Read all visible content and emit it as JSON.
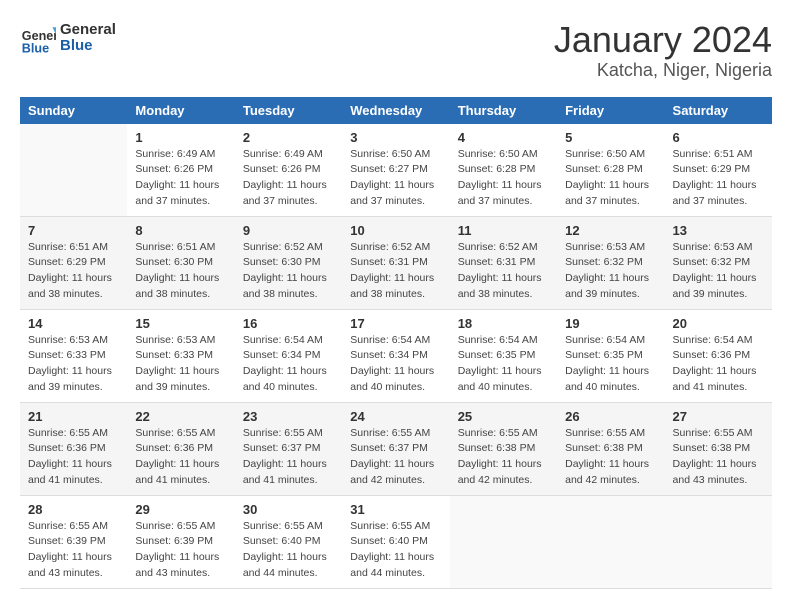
{
  "logo": {
    "text_general": "General",
    "text_blue": "Blue"
  },
  "title": {
    "month_year": "January 2024",
    "location": "Katcha, Niger, Nigeria"
  },
  "days_of_week": [
    "Sunday",
    "Monday",
    "Tuesday",
    "Wednesday",
    "Thursday",
    "Friday",
    "Saturday"
  ],
  "weeks": [
    [
      {
        "day": "",
        "info": ""
      },
      {
        "day": "1",
        "info": "Sunrise: 6:49 AM\nSunset: 6:26 PM\nDaylight: 11 hours\nand 37 minutes."
      },
      {
        "day": "2",
        "info": "Sunrise: 6:49 AM\nSunset: 6:26 PM\nDaylight: 11 hours\nand 37 minutes."
      },
      {
        "day": "3",
        "info": "Sunrise: 6:50 AM\nSunset: 6:27 PM\nDaylight: 11 hours\nand 37 minutes."
      },
      {
        "day": "4",
        "info": "Sunrise: 6:50 AM\nSunset: 6:28 PM\nDaylight: 11 hours\nand 37 minutes."
      },
      {
        "day": "5",
        "info": "Sunrise: 6:50 AM\nSunset: 6:28 PM\nDaylight: 11 hours\nand 37 minutes."
      },
      {
        "day": "6",
        "info": "Sunrise: 6:51 AM\nSunset: 6:29 PM\nDaylight: 11 hours\nand 37 minutes."
      }
    ],
    [
      {
        "day": "7",
        "info": "Sunrise: 6:51 AM\nSunset: 6:29 PM\nDaylight: 11 hours\nand 38 minutes."
      },
      {
        "day": "8",
        "info": "Sunrise: 6:51 AM\nSunset: 6:30 PM\nDaylight: 11 hours\nand 38 minutes."
      },
      {
        "day": "9",
        "info": "Sunrise: 6:52 AM\nSunset: 6:30 PM\nDaylight: 11 hours\nand 38 minutes."
      },
      {
        "day": "10",
        "info": "Sunrise: 6:52 AM\nSunset: 6:31 PM\nDaylight: 11 hours\nand 38 minutes."
      },
      {
        "day": "11",
        "info": "Sunrise: 6:52 AM\nSunset: 6:31 PM\nDaylight: 11 hours\nand 38 minutes."
      },
      {
        "day": "12",
        "info": "Sunrise: 6:53 AM\nSunset: 6:32 PM\nDaylight: 11 hours\nand 39 minutes."
      },
      {
        "day": "13",
        "info": "Sunrise: 6:53 AM\nSunset: 6:32 PM\nDaylight: 11 hours\nand 39 minutes."
      }
    ],
    [
      {
        "day": "14",
        "info": "Sunrise: 6:53 AM\nSunset: 6:33 PM\nDaylight: 11 hours\nand 39 minutes."
      },
      {
        "day": "15",
        "info": "Sunrise: 6:53 AM\nSunset: 6:33 PM\nDaylight: 11 hours\nand 39 minutes."
      },
      {
        "day": "16",
        "info": "Sunrise: 6:54 AM\nSunset: 6:34 PM\nDaylight: 11 hours\nand 40 minutes."
      },
      {
        "day": "17",
        "info": "Sunrise: 6:54 AM\nSunset: 6:34 PM\nDaylight: 11 hours\nand 40 minutes."
      },
      {
        "day": "18",
        "info": "Sunrise: 6:54 AM\nSunset: 6:35 PM\nDaylight: 11 hours\nand 40 minutes."
      },
      {
        "day": "19",
        "info": "Sunrise: 6:54 AM\nSunset: 6:35 PM\nDaylight: 11 hours\nand 40 minutes."
      },
      {
        "day": "20",
        "info": "Sunrise: 6:54 AM\nSunset: 6:36 PM\nDaylight: 11 hours\nand 41 minutes."
      }
    ],
    [
      {
        "day": "21",
        "info": "Sunrise: 6:55 AM\nSunset: 6:36 PM\nDaylight: 11 hours\nand 41 minutes."
      },
      {
        "day": "22",
        "info": "Sunrise: 6:55 AM\nSunset: 6:36 PM\nDaylight: 11 hours\nand 41 minutes."
      },
      {
        "day": "23",
        "info": "Sunrise: 6:55 AM\nSunset: 6:37 PM\nDaylight: 11 hours\nand 41 minutes."
      },
      {
        "day": "24",
        "info": "Sunrise: 6:55 AM\nSunset: 6:37 PM\nDaylight: 11 hours\nand 42 minutes."
      },
      {
        "day": "25",
        "info": "Sunrise: 6:55 AM\nSunset: 6:38 PM\nDaylight: 11 hours\nand 42 minutes."
      },
      {
        "day": "26",
        "info": "Sunrise: 6:55 AM\nSunset: 6:38 PM\nDaylight: 11 hours\nand 42 minutes."
      },
      {
        "day": "27",
        "info": "Sunrise: 6:55 AM\nSunset: 6:38 PM\nDaylight: 11 hours\nand 43 minutes."
      }
    ],
    [
      {
        "day": "28",
        "info": "Sunrise: 6:55 AM\nSunset: 6:39 PM\nDaylight: 11 hours\nand 43 minutes."
      },
      {
        "day": "29",
        "info": "Sunrise: 6:55 AM\nSunset: 6:39 PM\nDaylight: 11 hours\nand 43 minutes."
      },
      {
        "day": "30",
        "info": "Sunrise: 6:55 AM\nSunset: 6:40 PM\nDaylight: 11 hours\nand 44 minutes."
      },
      {
        "day": "31",
        "info": "Sunrise: 6:55 AM\nSunset: 6:40 PM\nDaylight: 11 hours\nand 44 minutes."
      },
      {
        "day": "",
        "info": ""
      },
      {
        "day": "",
        "info": ""
      },
      {
        "day": "",
        "info": ""
      }
    ]
  ]
}
